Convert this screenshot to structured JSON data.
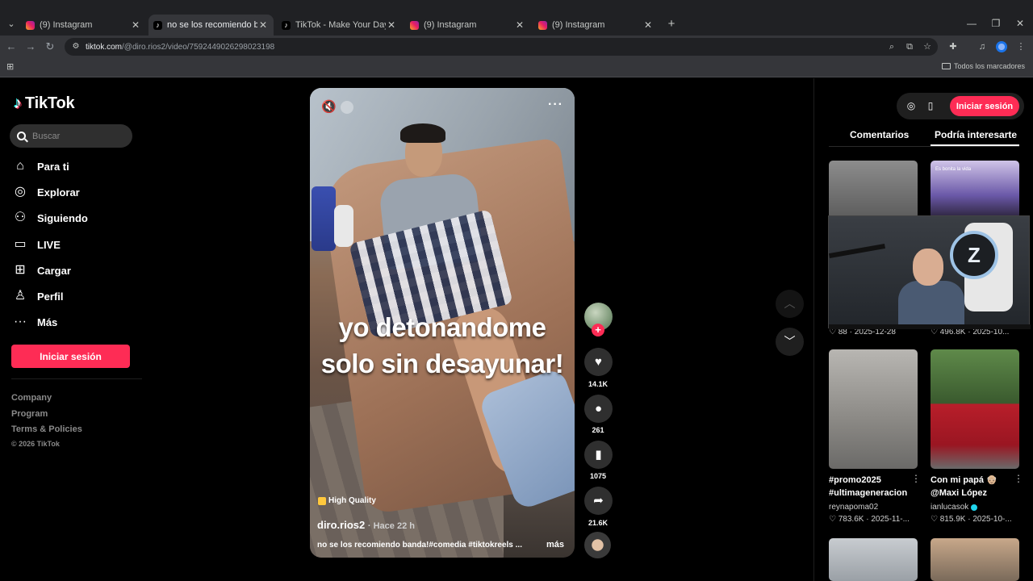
{
  "browser": {
    "tabs": [
      {
        "title": "(9) Instagram",
        "icon": "instagram-icon"
      },
      {
        "title": "no se los recomiendo banda!#c",
        "icon": "tiktok-icon"
      },
      {
        "title": "TikTok - Make Your Day",
        "icon": "tiktok-icon"
      },
      {
        "title": "(9) Instagram",
        "icon": "instagram-icon"
      },
      {
        "title": "(9) Instagram",
        "icon": "instagram-icon"
      }
    ],
    "active_tab_index": 1,
    "url_host": "tiktok.com",
    "url_path": "/@diro.rios2/video/7592449026298023198",
    "bookmarks_label": "Todos los marcadores"
  },
  "sidebar": {
    "brand": "TikTok",
    "search_placeholder": "Buscar",
    "nav": [
      {
        "label": "Para ti",
        "icon": "home-icon"
      },
      {
        "label": "Explorar",
        "icon": "compass-icon"
      },
      {
        "label": "Siguiendo",
        "icon": "following-icon"
      },
      {
        "label": "LIVE",
        "icon": "live-tv-icon"
      },
      {
        "label": "Cargar",
        "icon": "upload-icon"
      },
      {
        "label": "Perfil",
        "icon": "profile-icon"
      },
      {
        "label": "Más",
        "icon": "more-icon"
      }
    ],
    "login_label": "Iniciar sesión",
    "footer": [
      "Company",
      "Program",
      "Terms & Policies"
    ],
    "copyright": "© 2026 TikTok"
  },
  "video": {
    "overlay_line1": "yo detonandome",
    "overlay_line2": "solo sin desayunar!",
    "quality_badge": "High Quality",
    "author": "diro.rios2",
    "age": "· Hace 22 h",
    "description": "no se los recomiendo banda!#comedia #tiktokreels ...",
    "more_label": "más"
  },
  "actions": {
    "likes": "14.1K",
    "comments": "261",
    "saves": "1075",
    "shares": "21.6K"
  },
  "right_panel": {
    "login_label": "Iniciar sesión",
    "tabs": [
      "Comentarios",
      "Podría interesarte"
    ],
    "active_tab_index": 1,
    "thumb_b_caption": "Es bonita la vida",
    "top_row_stats": [
      "♡ 88 · 2025-12-28",
      "♡ 496.8K · 2025-10..."
    ],
    "cards": [
      {
        "title": "#promo2025 #ultimageneracion",
        "author": "reynapoma02",
        "verified": false,
        "stats": "♡ 783.6K · 2025-11-..."
      },
      {
        "title": "Con mi papá 👴🏼 @Maxi López",
        "author": "ianlucasok",
        "verified": true,
        "stats": "♡ 815.9K · 2025-10-..."
      }
    ]
  }
}
